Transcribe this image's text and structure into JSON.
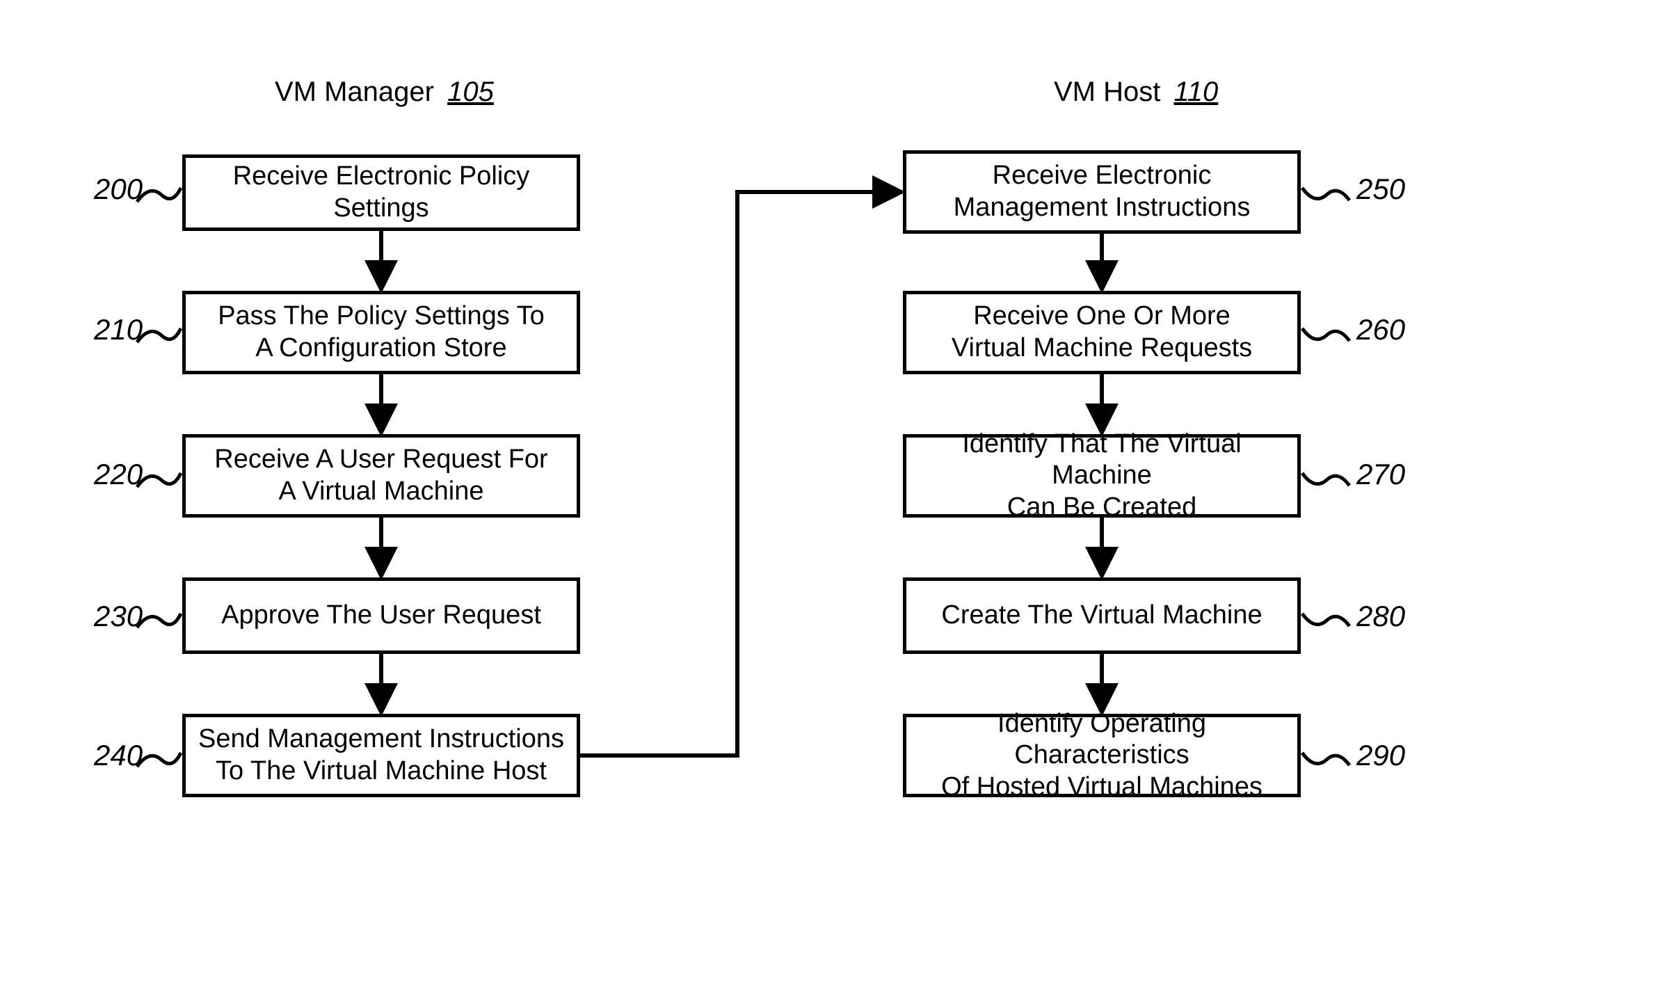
{
  "headings": {
    "left": {
      "title": "VM Manager",
      "ref": "105"
    },
    "right": {
      "title": "VM Host",
      "ref": "110"
    }
  },
  "left_boxes": [
    {
      "ref": "200",
      "text": "Receive Electronic Policy Settings"
    },
    {
      "ref": "210",
      "text": "Pass The Policy Settings To\nA Configuration Store"
    },
    {
      "ref": "220",
      "text": "Receive A User Request For\nA Virtual Machine"
    },
    {
      "ref": "230",
      "text": "Approve The User Request"
    },
    {
      "ref": "240",
      "text": "Send Management Instructions\nTo The Virtual Machine Host"
    }
  ],
  "right_boxes": [
    {
      "ref": "250",
      "text": "Receive Electronic\nManagement Instructions"
    },
    {
      "ref": "260",
      "text": "Receive One Or More\nVirtual Machine Requests"
    },
    {
      "ref": "270",
      "text": "Identify That The Virtual Machine\nCan Be Created"
    },
    {
      "ref": "280",
      "text": "Create The Virtual Machine"
    },
    {
      "ref": "290",
      "text": "Identify Operating Characteristics\nOf Hosted Virtual Machines"
    }
  ]
}
